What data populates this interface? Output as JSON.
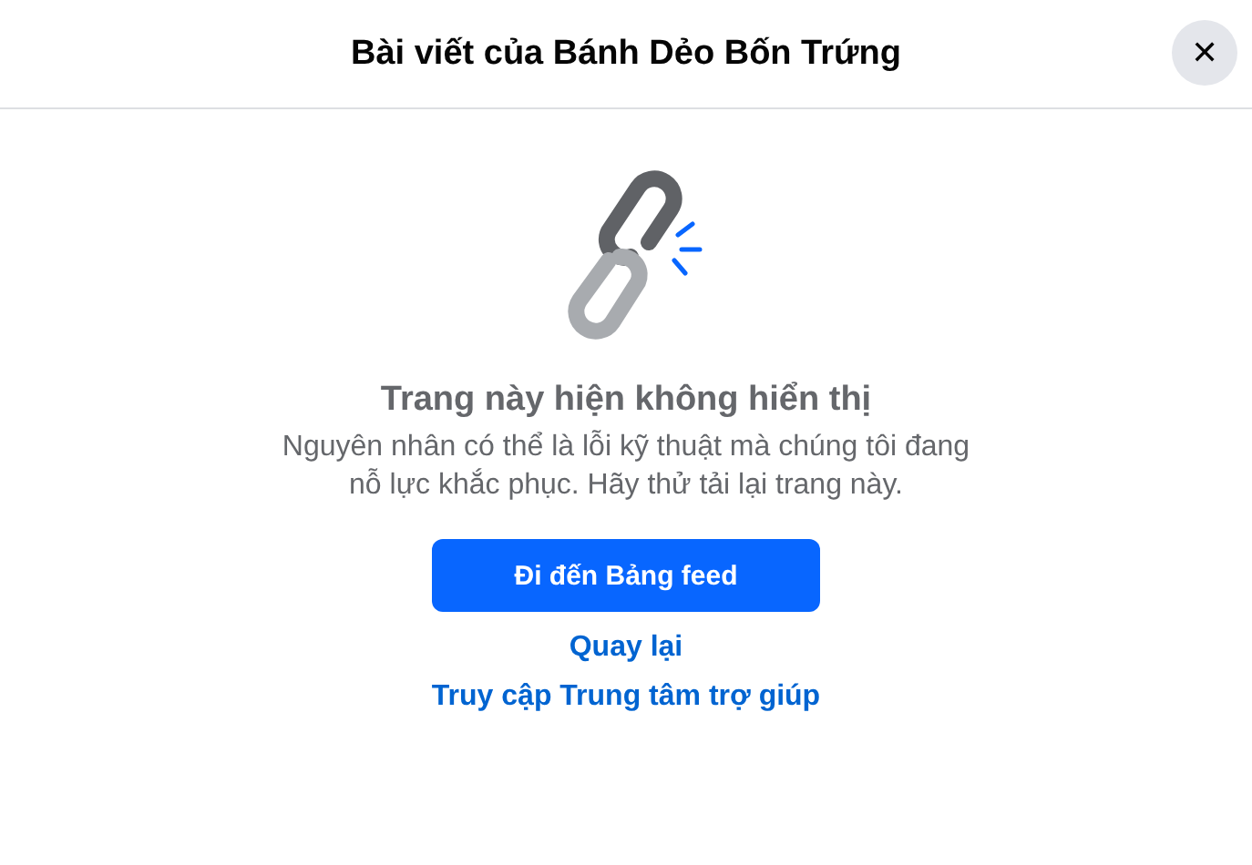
{
  "dialog": {
    "title": "Bài viết của Bánh Dẻo Bốn Trứng",
    "close_label": "✕"
  },
  "error": {
    "heading": "Trang này hiện không hiển thị",
    "message": "Nguyên nhân có thể là lỗi kỹ thuật mà chúng tôi đang nỗ lực khắc phục. Hãy thử tải lại trang này."
  },
  "button": "Đi đến Bảng feed",
  "links": [
    "Quay lại",
    "Truy cập Trung tâm trợ giúp"
  ]
}
